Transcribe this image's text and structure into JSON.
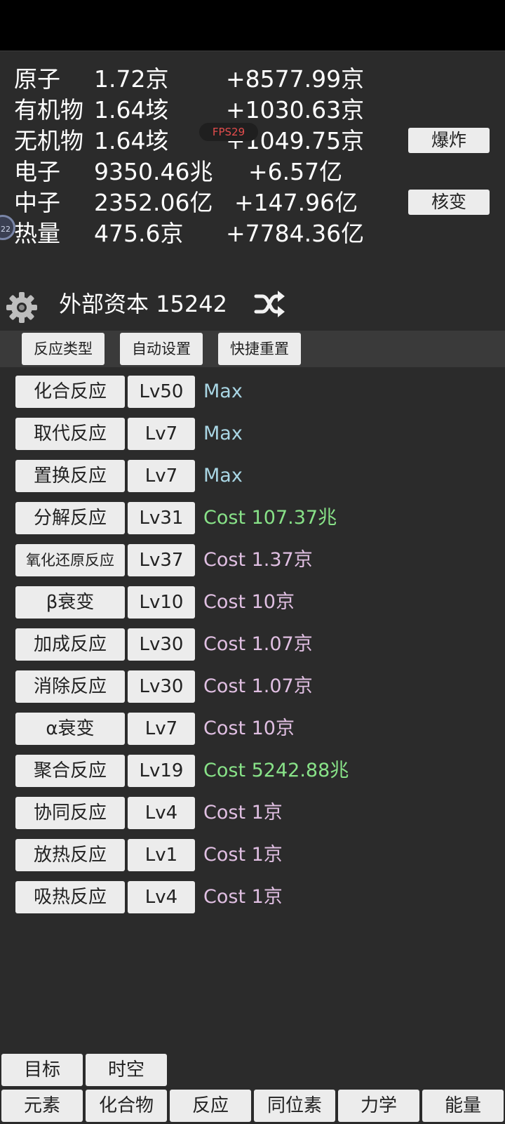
{
  "resources": [
    {
      "name": "原子",
      "amount": "1.72京",
      "rate": "+8577.99京"
    },
    {
      "name": "有机物",
      "amount": "1.64垓",
      "rate": "+1030.63京"
    },
    {
      "name": "无机物",
      "amount": "1.64垓",
      "rate": "+1049.75京"
    },
    {
      "name": "电子",
      "amount": "9350.46兆",
      "rate": "+6.57亿"
    },
    {
      "name": "中子",
      "amount": "2352.06亿",
      "rate": "+147.96亿"
    },
    {
      "name": "热量",
      "amount": "475.6京",
      "rate": "+7784.36亿"
    }
  ],
  "fps_label": "FPS29",
  "actions": {
    "explode": "爆炸",
    "nuclear": "核变"
  },
  "side_badge": "22",
  "capital": {
    "label": "外部资本",
    "value": "15242"
  },
  "sub_tabs": [
    "反应类型",
    "自动设置",
    "快捷重置"
  ],
  "reactions": [
    {
      "name": "化合反应",
      "level": "Lv50",
      "status": "Max",
      "color": "#a9d6e4"
    },
    {
      "name": "取代反应",
      "level": "Lv7",
      "status": "Max",
      "color": "#a9d6e4"
    },
    {
      "name": "置换反应",
      "level": "Lv7",
      "status": "Max",
      "color": "#a9d6e4"
    },
    {
      "name": "分解反应",
      "level": "Lv31",
      "status": "Cost 107.37兆",
      "color": "#88e288"
    },
    {
      "name": "氧化还原反应",
      "level": "Lv37",
      "status": "Cost 1.37京",
      "color": "#e0bfe2"
    },
    {
      "name": "β衰变",
      "level": "Lv10",
      "status": "Cost 10京",
      "color": "#e0bfe2"
    },
    {
      "name": "加成反应",
      "level": "Lv30",
      "status": "Cost 1.07京",
      "color": "#e0bfe2"
    },
    {
      "name": "消除反应",
      "level": "Lv30",
      "status": "Cost 1.07京",
      "color": "#e0bfe2"
    },
    {
      "name": "α衰变",
      "level": "Lv7",
      "status": "Cost 10京",
      "color": "#e0bfe2"
    },
    {
      "name": "聚合反应",
      "level": "Lv19",
      "status": "Cost 5242.88兆",
      "color": "#88e288"
    },
    {
      "name": "协同反应",
      "level": "Lv4",
      "status": "Cost 1京",
      "color": "#e0bfe2"
    },
    {
      "name": "放热反应",
      "level": "Lv1",
      "status": "Cost 1京",
      "color": "#e0bfe2"
    },
    {
      "name": "吸热反应",
      "level": "Lv4",
      "status": "Cost 1京",
      "color": "#e0bfe2"
    }
  ],
  "bottom_upper": [
    "目标",
    "时空"
  ],
  "bottom_nav": [
    "元素",
    "化合物",
    "反应",
    "同位素",
    "力学",
    "能量"
  ]
}
